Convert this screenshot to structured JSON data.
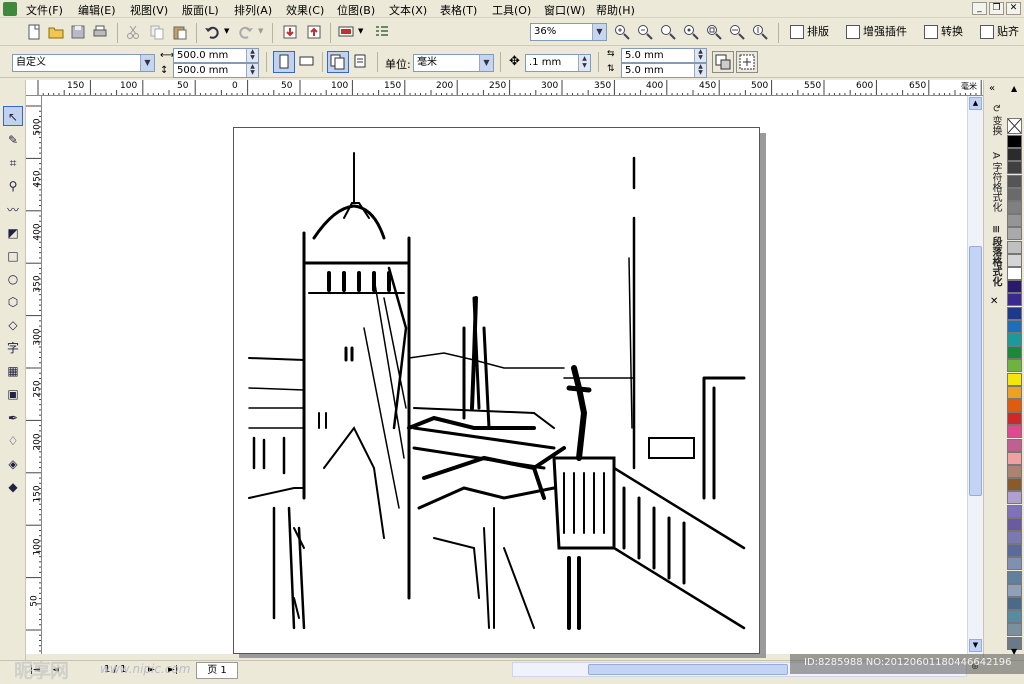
{
  "menubar": {
    "items": [
      "文件(F)",
      "编辑(E)",
      "视图(V)",
      "版面(L)",
      "排列(A)",
      "效果(C)",
      "位图(B)",
      "文本(X)",
      "表格(T)",
      "工具(O)",
      "窗口(W)",
      "帮助(H)"
    ],
    "min": "_",
    "restore": "❐",
    "close": "✕"
  },
  "toolbar1": {
    "zoom_value": "36%",
    "btn_layout": "排版",
    "btn_plugins": "增强插件",
    "btn_convert": "转换",
    "btn_snap": "贴齐"
  },
  "toolbar2": {
    "paper_preset": "自定义",
    "width": "500.0 mm",
    "height": "500.0 mm",
    "unit_label": "单位:",
    "unit_value": "毫米",
    "nudge": ".1 mm",
    "dup_x": "5.0 mm",
    "dup_y": "5.0 mm"
  },
  "ruler_top": {
    "labels": [
      "150",
      "100",
      "50",
      "0",
      "50",
      "100",
      "150",
      "200",
      "250",
      "300",
      "350",
      "400",
      "450",
      "500",
      "550",
      "600",
      "650"
    ],
    "unit": "毫米"
  },
  "ruler_left": {
    "labels": [
      "500",
      "450",
      "400",
      "350",
      "300",
      "250",
      "200",
      "150",
      "100",
      "50"
    ]
  },
  "dockers": [
    {
      "icon": "transform-icon",
      "label": "变换"
    },
    {
      "icon": "char-format-icon",
      "label": "字符格式化"
    },
    {
      "icon": "para-format-icon",
      "label": "段落格式化"
    }
  ],
  "palette": {
    "colors": [
      "#000000",
      "#2b2b2b",
      "#404040",
      "#555555",
      "#6a6a6a",
      "#808080",
      "#959595",
      "#aaaaaa",
      "#c0c0c0",
      "#d5d5d5",
      "#ffffff",
      "#2a1a6e",
      "#3a2a90",
      "#1b3a8c",
      "#1e6fb8",
      "#1a9a9a",
      "#1a8a3a",
      "#6db33f",
      "#f5e60a",
      "#f0a020",
      "#e05a10",
      "#d02828",
      "#e04890",
      "#c06090",
      "#f0a0a0",
      "#b08070",
      "#8b5a2b",
      "#b0a0d0",
      "#8070c0",
      "#6a5aa0",
      "#7a7ab0",
      "#5a6a9a",
      "#8090b0",
      "#6080a0",
      "#90a0b8",
      "#4a6a8a",
      "#5a8aa0",
      "#7a90a0",
      "#6a7a8a"
    ]
  },
  "bottombar": {
    "page_counter": "1 / 1",
    "page_tab": "页 1",
    "nav_first": "|◄",
    "nav_prev": "◄",
    "nav_next": "►",
    "nav_last": "►|"
  },
  "watermark": {
    "id_text": "ID:8285988 NO:20120601180446642196",
    "logo": "昵享网",
    "url": "www.nipic.com"
  }
}
